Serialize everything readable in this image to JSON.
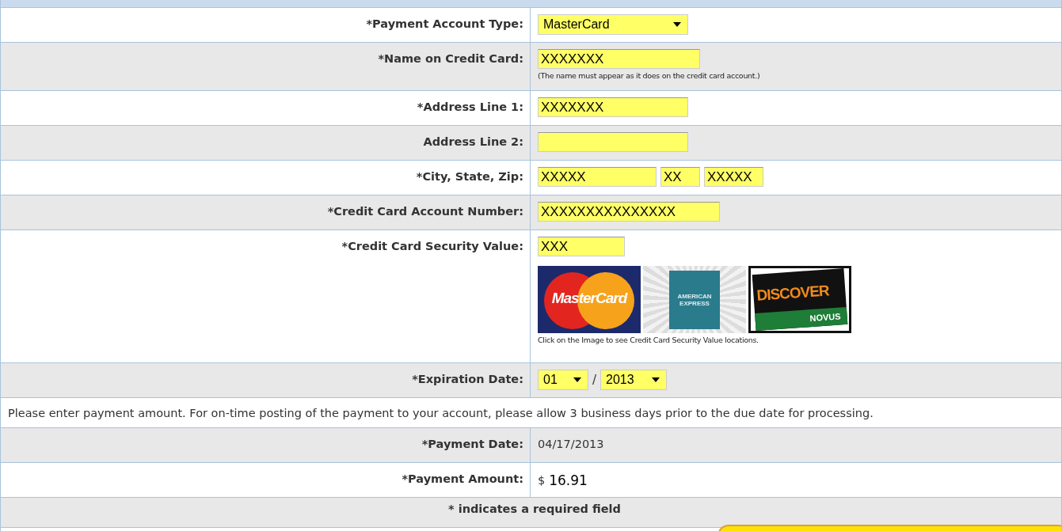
{
  "rows": [
    {
      "label": "*Payment Account Type:",
      "fields": [
        {
          "kind": "select",
          "value": "MasterCard"
        }
      ]
    },
    {
      "label": "*Name on Credit Card:",
      "fields": [
        {
          "kind": "input",
          "value": "XXXXXXX"
        }
      ],
      "hint": "(The name must appear as it does on the credit card account.)"
    },
    {
      "label": "*Address Line 1:",
      "fields": [
        {
          "kind": "input",
          "value": "XXXXXXX"
        }
      ]
    },
    {
      "label": "Address Line 2:",
      "fields": [
        {
          "kind": "input"
        }
      ]
    },
    {
      "label": "*City, State, Zip:",
      "fields": [
        {
          "kind": "input",
          "value": "XXXXX"
        },
        {
          "kind": "input",
          "value": "XX"
        },
        {
          "kind": "input",
          "value": "XXXXX"
        }
      ]
    },
    {
      "label": "*Credit Card Account Number:",
      "fields": [
        {
          "kind": "input",
          "value": "XXXXXXXXXXXXXXX"
        }
      ]
    },
    {
      "label": "*Credit Card Security Value:",
      "fields": [
        {
          "kind": "input",
          "value": "XXX"
        }
      ],
      "cards": [
        {
          "kind": "mastercard",
          "texts": [
            "MasterCard"
          ]
        },
        {
          "kind": "amex",
          "texts": [
            "AMERICAN",
            "EXPRESS"
          ]
        },
        {
          "kind": "discover",
          "texts": [
            "DISCOVER",
            "NOVUS"
          ]
        }
      ],
      "hint": "Click on the Image to see Credit Card Security Value locations."
    },
    {
      "label": "*Expiration Date:",
      "fields": [
        {
          "kind": "select",
          "value": "01"
        },
        {
          "kind": "separator",
          "value": "/"
        },
        {
          "kind": "select",
          "value": "2013"
        }
      ]
    },
    {
      "note": "Please enter payment amount. For on-time posting of the payment to your account, please allow 3 business days prior to the due date for processing."
    },
    {
      "label": "*Payment Date:",
      "fields": [
        {
          "kind": "text",
          "value": "04/17/2013"
        }
      ]
    },
    {
      "label": "*Payment Amount:",
      "fields": [
        {
          "kind": "currency",
          "value": "$"
        },
        {
          "kind": "amount",
          "value": "16.91"
        }
      ]
    },
    {
      "footer": "* indicates a required field"
    }
  ]
}
